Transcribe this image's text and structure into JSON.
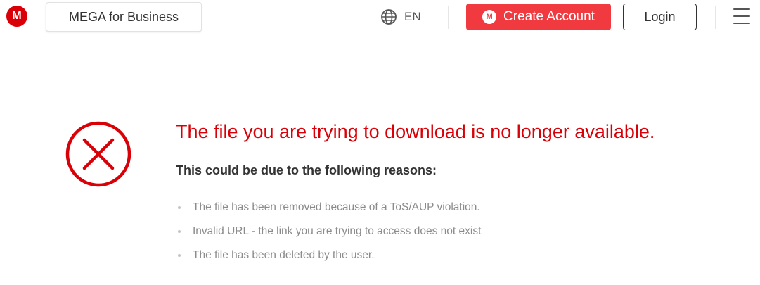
{
  "header": {
    "logo_letter": "M",
    "business_label": "MEGA for Business",
    "language": "EN",
    "create_account_label": "Create Account",
    "create_account_logo_letter": "M",
    "login_label": "Login",
    "brand_color": "#d90007",
    "button_color": "#f03a3f"
  },
  "main": {
    "title": "The file you are trying to download is no longer available.",
    "subtitle": "This could be due to the following reasons:",
    "reasons": [
      "The file has been removed because of a ToS/AUP violation.",
      "Invalid URL - the link you are trying to access does not exist",
      "The file has been deleted by the user."
    ],
    "icon": "error-x-circle-icon"
  }
}
